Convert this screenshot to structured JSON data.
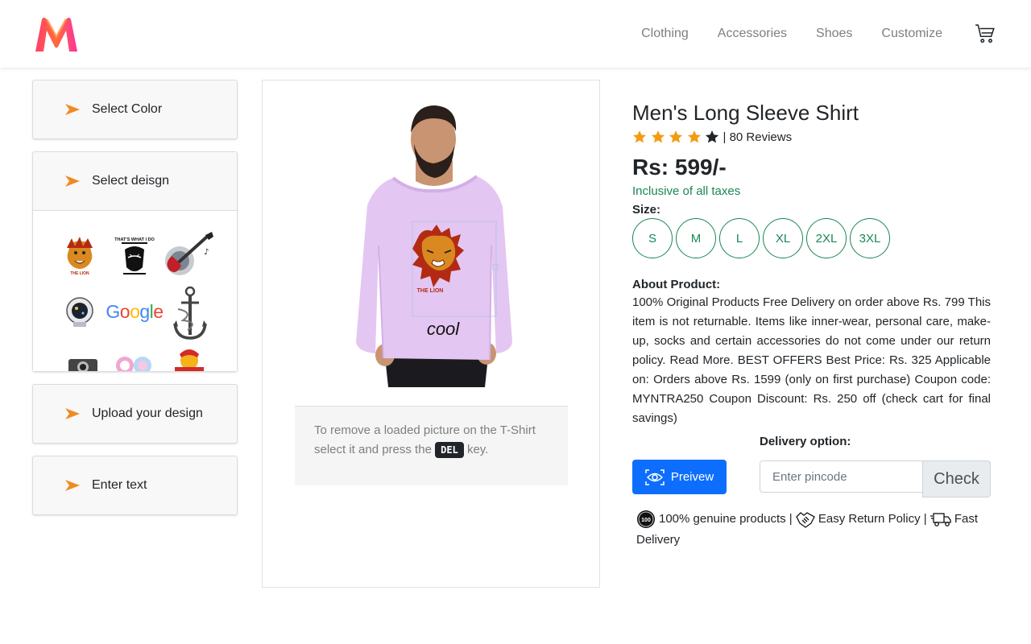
{
  "nav": {
    "links": [
      "Clothing",
      "Accessories",
      "Shoes",
      "Customize"
    ]
  },
  "sidebar": {
    "select_color": "Select Color",
    "select_design": "Select deisgn",
    "upload_design": "Upload your design",
    "enter_text": "Enter text",
    "designs": {
      "google_logo": "Google",
      "lion_text": "THE LION",
      "beard_text": "THAT'S WHAT I DO"
    }
  },
  "canvas": {
    "shirt_text": "cool",
    "lion_label": "THE LION",
    "hint_before": "To remove a loaded picture on the T-Shirt select it and press the",
    "hint_key": "DEL",
    "hint_after": "key."
  },
  "product": {
    "title": "Men's Long Sleeve Shirt",
    "rating": 4,
    "rating_max": 5,
    "reviews": "| 80 Reviews",
    "price": "Rs: 599/-",
    "tax_note": "Inclusive of all taxes",
    "size_label": "Size:",
    "sizes": [
      "S",
      "M",
      "L",
      "XL",
      "2XL",
      "3XL"
    ],
    "about_label": "About Product:",
    "about_text": "100% Original Products Free Delivery on order above Rs. 799 This item is not returnable. Items like inner-wear, personal care, make-up, socks and certain accessories do not come under our return policy. Read More. BEST OFFERS Best Price: Rs. 325 Applicable on: Orders above Rs. 1599 (only on first purchase) Coupon code: MYNTRA250 Coupon Discount: Rs. 250 off (check cart for final savings)",
    "preview_label": "Preivew",
    "delivery_label": "Delivery option:",
    "pincode_placeholder": "Enter pincode",
    "check_label": "Check",
    "features": {
      "badge": "100",
      "genuine": "100% genuine products |",
      "returns": "Easy Return Policy |",
      "delivery": "Fast Delivery"
    }
  },
  "colors": {
    "accent_green": "#198754",
    "primary_blue": "#0d6efd",
    "shirt_lilac": "#e4c6f2",
    "arrow_orange": "#f08a24"
  }
}
